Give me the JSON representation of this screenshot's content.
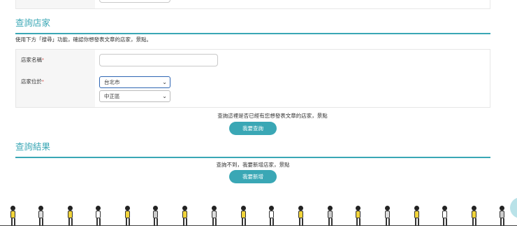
{
  "section1": {
    "title": "查詢店家",
    "description": "使用下方「搜尋」功能，確認你想發表文章的店家，景點。",
    "fields": {
      "name_label": "店家名稱",
      "location_label": "店家位於",
      "required_mark": "*",
      "name_value": "",
      "city_selected": "台北市",
      "district_selected": "中正區"
    },
    "hint": "查詢這裡是否已經有您想發表文章的店家，景點",
    "search_button": "我要查詢"
  },
  "section2": {
    "title": "查詢結果",
    "hint": "查詢不到，我要新增店家，景點",
    "add_button": "我要新增"
  },
  "colors": {
    "accent": "#3aa7b5",
    "required": "#d9534f",
    "focus_border": "#2f66b3",
    "figure_yellow": "#f1d43a"
  }
}
